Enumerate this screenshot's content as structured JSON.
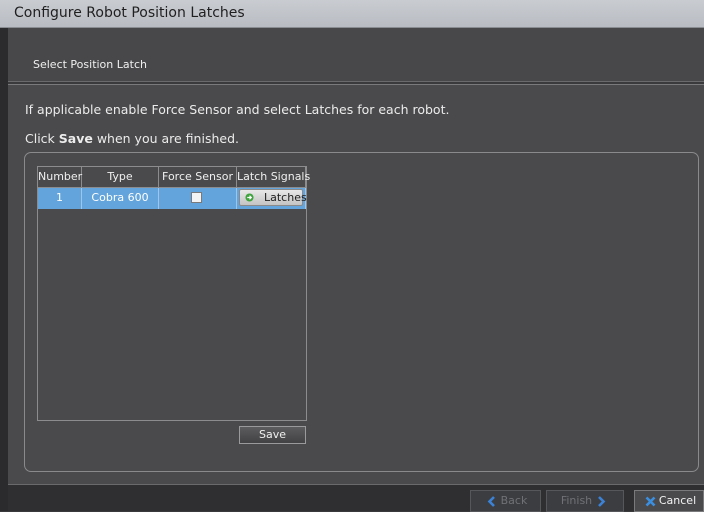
{
  "window": {
    "title": "Configure Robot Position Latches"
  },
  "header": {
    "subtitle": "Select Position Latch"
  },
  "instructions": {
    "line1": "If applicable enable Force Sensor and select Latches for each robot.",
    "line2_prefix": "Click ",
    "line2_bold": "Save",
    "line2_suffix": " when you are finished."
  },
  "grid": {
    "columns": [
      "Number",
      "Type",
      "Force Sensor",
      "Latch Signals"
    ],
    "rows": [
      {
        "number": "1",
        "type": "Cobra 600",
        "force_sensor": false,
        "latch_label": "Latches"
      }
    ]
  },
  "save_label": "Save",
  "footer": {
    "back_label": "Back",
    "finish_label": "Finish",
    "cancel_label": "Cancel"
  },
  "colors": {
    "selected_row": "#62a4db",
    "background": "#4a4a4c",
    "titlebar": "#c3c6cc",
    "accent_arrow": "#3b82d6",
    "cancel_x": "#3b8fe0",
    "latch_arrow": "#3da33d"
  },
  "icons": {
    "latch": "green-arrow-icon",
    "back": "back-arrow-icon",
    "finish": "forward-arrow-icon",
    "cancel": "x-icon"
  }
}
